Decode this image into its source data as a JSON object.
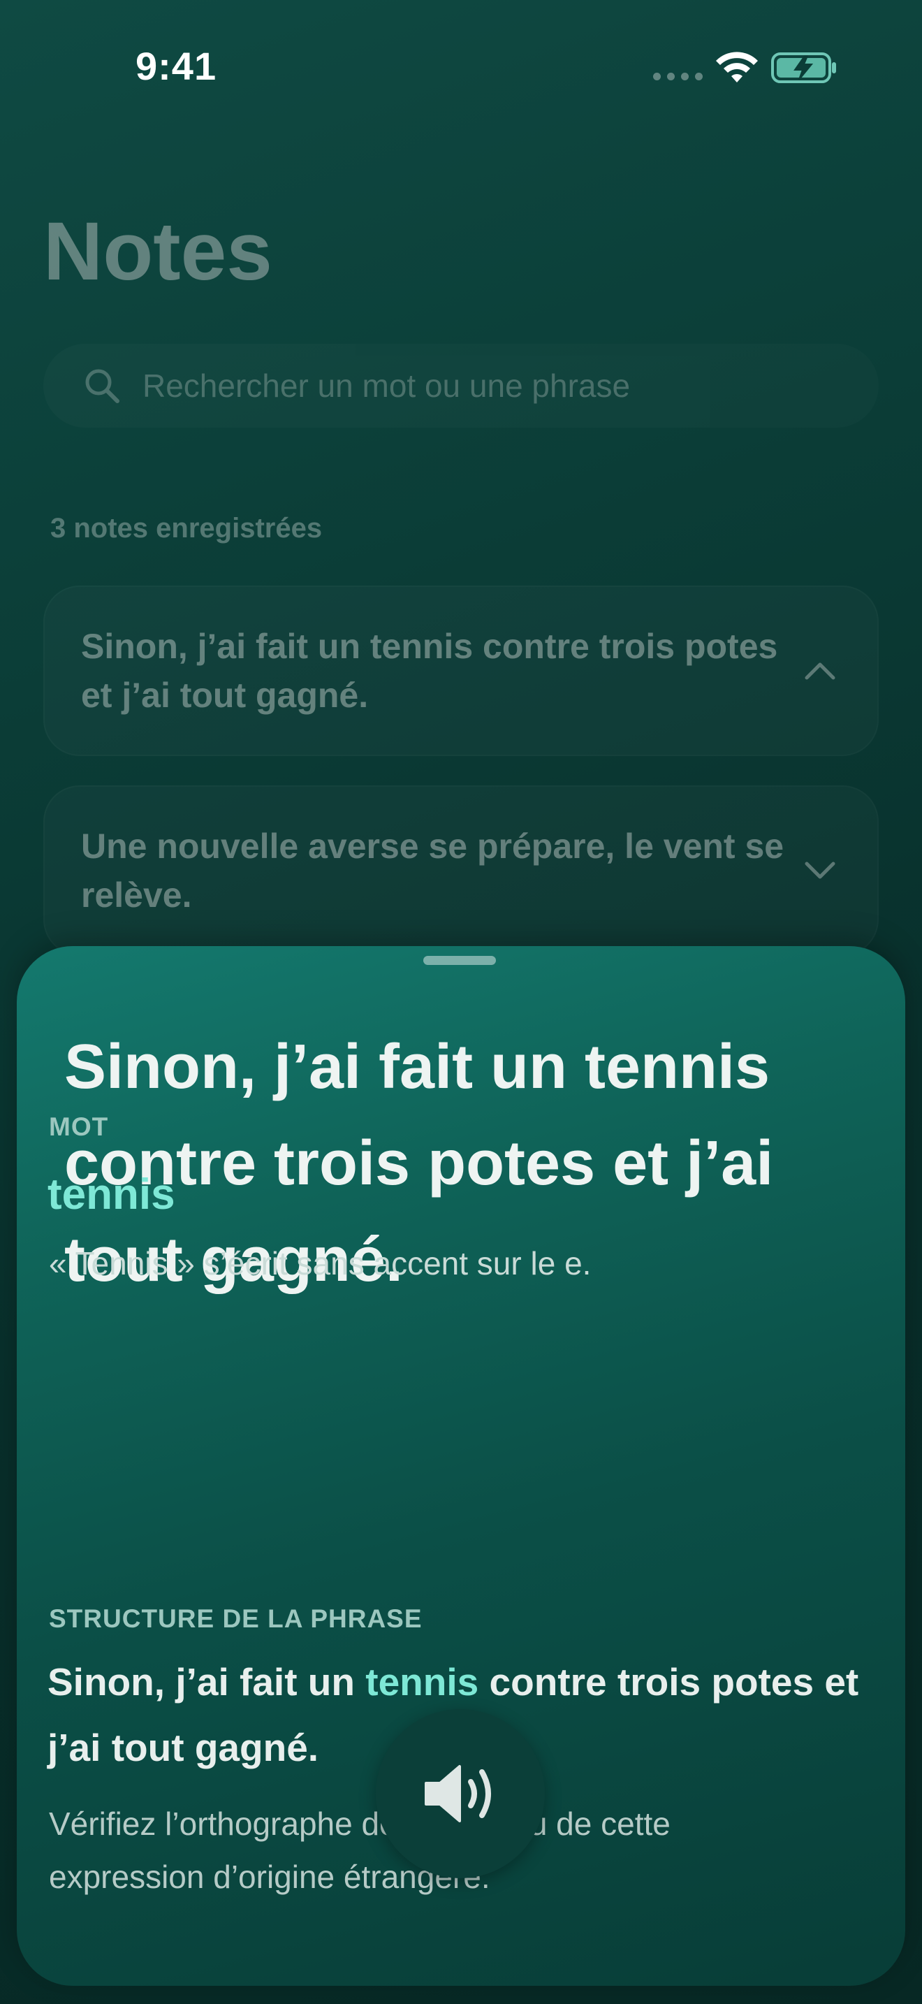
{
  "status_bar": {
    "time": "9:41"
  },
  "background": {
    "title": "Notes",
    "search": {
      "placeholder": "Rechercher un mot ou une phrase"
    },
    "count_label": "3 notes enregistrées",
    "notes": [
      {
        "text": "Sinon, j’ai fait un tennis contre trois potes et j’ai tout gagné.",
        "expanded": true
      },
      {
        "text": "Une nouvelle averse se prépare, le vent se relève.",
        "expanded": false
      }
    ]
  },
  "sheet": {
    "title": "Sinon, j’ai fait un tennis contre trois potes et j’ai tout gagné.",
    "word_section": {
      "label": "MOT",
      "word": "tennis",
      "explanation": "« Tennis » s’écrit sans accent sur le e."
    },
    "structure_section": {
      "label": "STRUCTURE DE LA PHRASE",
      "sentence_before": "Sinon, j’ai fait un ",
      "sentence_highlight": "tennis",
      "sentence_after": " contre trois potes et j’ai tout gagné.",
      "note": "Vérifiez l’orthographe de ce mot ou de cette expression d’origine étrangère."
    },
    "speaker_icon": "speaker-wave-icon"
  },
  "colors": {
    "accent": "#7ee8d6",
    "sheet_top": "#14796e",
    "sheet_bottom": "#083d37",
    "background": "#0b3d37"
  }
}
